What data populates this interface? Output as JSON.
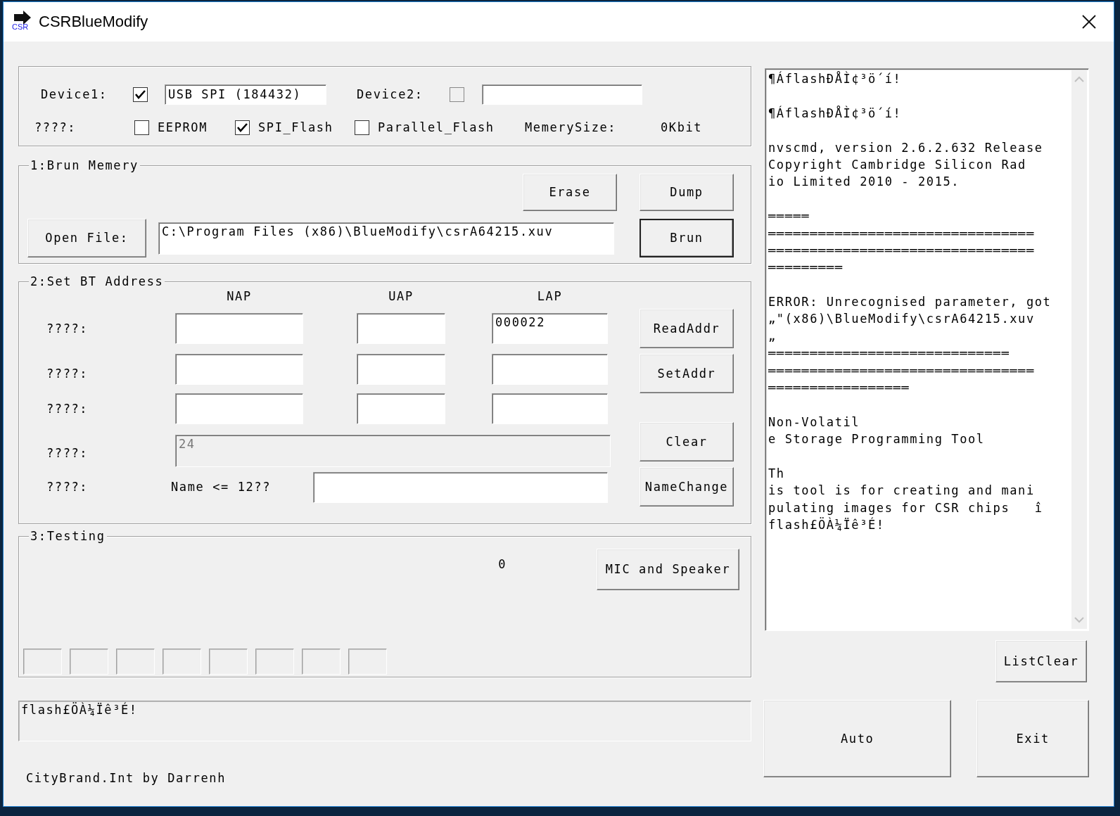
{
  "window": {
    "title": "CSRBlueModify",
    "icon_label": "CSR"
  },
  "device": {
    "device1": {
      "label": "Device1:",
      "checked": true,
      "value": "USB SPI (184432)"
    },
    "device2": {
      "label": "Device2:",
      "checked": false,
      "disabled": true
    },
    "memory_label": "????:",
    "memory_types": [
      {
        "label": "EEPROM",
        "checked": false
      },
      {
        "label": "SPI_Flash",
        "checked": true
      },
      {
        "label": "Parallel_Flash",
        "checked": false
      }
    ],
    "memory_size_label": "MemerySize:",
    "memory_size": "0Kbit"
  },
  "burn": {
    "title": "1:Brun Memery",
    "erase_button": "Erase",
    "dump_button": "Dump",
    "open_file_button": "Open File:",
    "file_path": "C:\\Program Files (x86)\\BlueModify\\csrA64215.xuv",
    "burn_button": "Brun"
  },
  "bt_address": {
    "title": "2:Set BT Address",
    "columns": [
      "NAP",
      "UAP",
      "LAP"
    ],
    "rows": [
      {
        "label": "????:",
        "lap": "000022"
      },
      {
        "label": "????:"
      },
      {
        "label": "????:"
      }
    ],
    "extra_row": {
      "label": "????:",
      "value": "24",
      "disabled": true
    },
    "name_row": {
      "label": "????:",
      "hint": "Name <= 12??"
    },
    "read_button": "ReadAddr",
    "set_button": "SetAddr",
    "clear_button": "Clear",
    "name_button": "NameChange"
  },
  "testing": {
    "title": "3:Testing",
    "counter": "0",
    "button": "MIC and Speaker",
    "indicators": [
      {
        "on": false
      },
      {
        "on": false
      },
      {
        "on": false
      },
      {
        "on": false
      },
      {
        "on": false
      },
      {
        "on": false
      },
      {
        "on": false
      },
      {
        "on": false
      }
    ]
  },
  "status": "flash£ÖÀ¼Ïê³É!",
  "footer": "CityBrand.Int by Darrenh",
  "log": {
    "blocks": [
      [
        "¶ÁflashÐÅÌ¢³ö´í!"
      ],
      [
        "¶ÁflashÐÅÌ¢³ö´í!"
      ],
      [
        "nvscmd, version 2.6.2.632 Release",
        "Copyright Cambridge Silicon Rad",
        "io Limited 2010 - 2015."
      ],
      [
        "═════",
        "════════════════════════════════",
        "════════════════════════════════",
        "═════════"
      ],
      [
        "ERROR: Unrecognised parameter, got",
        "„\"(x86)\\BlueModify\\csrA64215.xuv",
        "„",
        "═════════════════════════════",
        "════════════════════════════════",
        "═════════════════"
      ],
      [
        "Non-Volatil",
        "e Storage Programming Tool"
      ],
      [
        "Th",
        "is tool is for creating and mani",
        "pulating images for CSR chips   î",
        "flash£ÖÀ¼Ïê³É!"
      ]
    ]
  },
  "list_clear_button": "ListClear",
  "auto_button": "Auto",
  "exit_button": "Exit"
}
